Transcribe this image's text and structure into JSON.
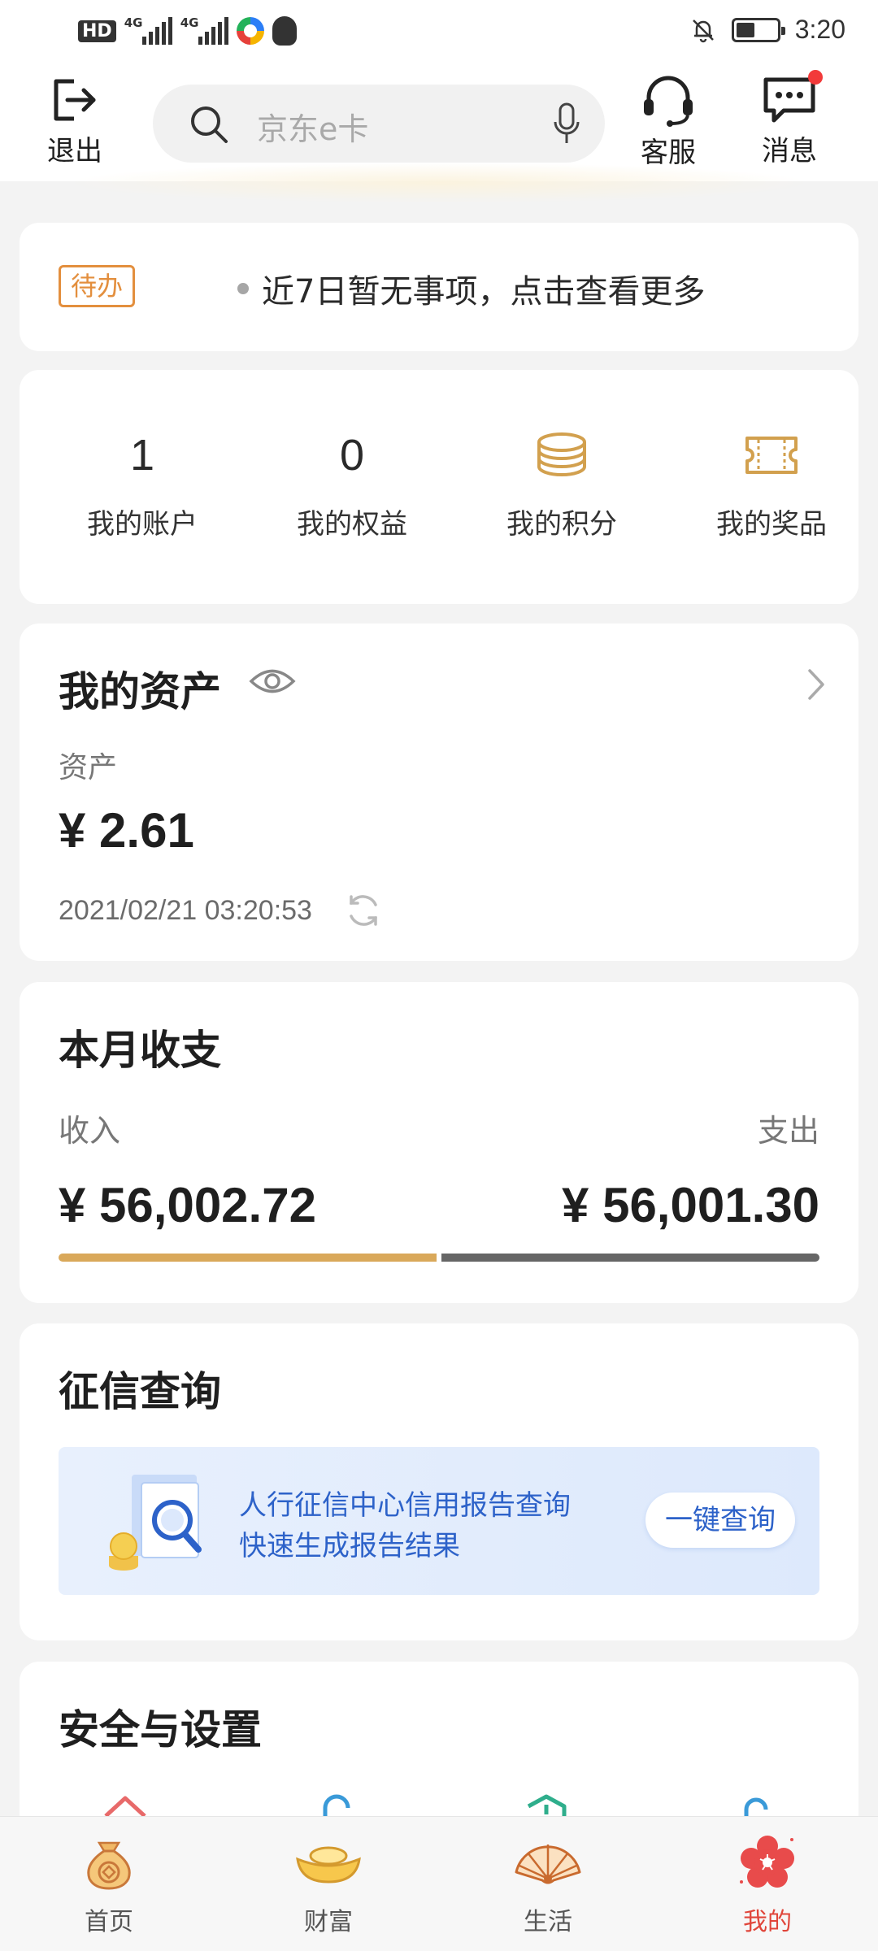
{
  "status_bar": {
    "left_icons": [
      "hd-icon",
      "signal-4g-icon",
      "signal-4g-icon",
      "app-icon",
      "qq-icon"
    ],
    "right_icons": [
      "bell-off-icon",
      "battery-icon"
    ],
    "time": "3:20"
  },
  "header": {
    "logout_label": "退出",
    "search_placeholder": "京东e卡",
    "service_label": "客服",
    "messages_label": "消息",
    "has_unread_dot": true
  },
  "todo": {
    "tag": "待办",
    "text": "近7日暂无事项，点击查看更多"
  },
  "stats": [
    {
      "value": "1",
      "label": "我的账户"
    },
    {
      "value": "0",
      "label": "我的权益"
    },
    {
      "icon": "coins-icon",
      "label": "我的积分"
    },
    {
      "icon": "ticket-icon",
      "label": "我的奖品"
    }
  ],
  "assets": {
    "title": "我的资产",
    "sublabel": "资产",
    "amount": "¥ 2.61",
    "timestamp": "2021/02/21 03:20:53"
  },
  "monthly": {
    "title": "本月收支",
    "income_label": "收入",
    "expense_label": "支出",
    "income_amount": "¥ 56,002.72",
    "expense_amount": "¥ 56,001.30",
    "income_value": 56002.72,
    "expense_value": 56001.3,
    "colors": {
      "income": "#d9a85a",
      "expense": "#666666"
    }
  },
  "credit": {
    "title": "征信查询",
    "line1": "人行征信中心信用报告查询",
    "line2": "快速生成报告结果",
    "button": "一键查询"
  },
  "security": {
    "title": "安全与设置",
    "icons": [
      "home-icon",
      "lock-icon",
      "shield-icon",
      "lock-icon"
    ]
  },
  "tabs": [
    {
      "label": "首页",
      "icon": "money-bag-icon",
      "active": false
    },
    {
      "label": "财富",
      "icon": "gold-ingot-icon",
      "active": false
    },
    {
      "label": "生活",
      "icon": "fan-icon",
      "active": false
    },
    {
      "label": "我的",
      "icon": "plum-blossom-icon",
      "active": true
    }
  ],
  "colors": {
    "accent_orange": "#e38f3e",
    "accent_gold": "#d9a85a",
    "link_blue": "#2d62c9",
    "active_red": "#e0453a"
  }
}
